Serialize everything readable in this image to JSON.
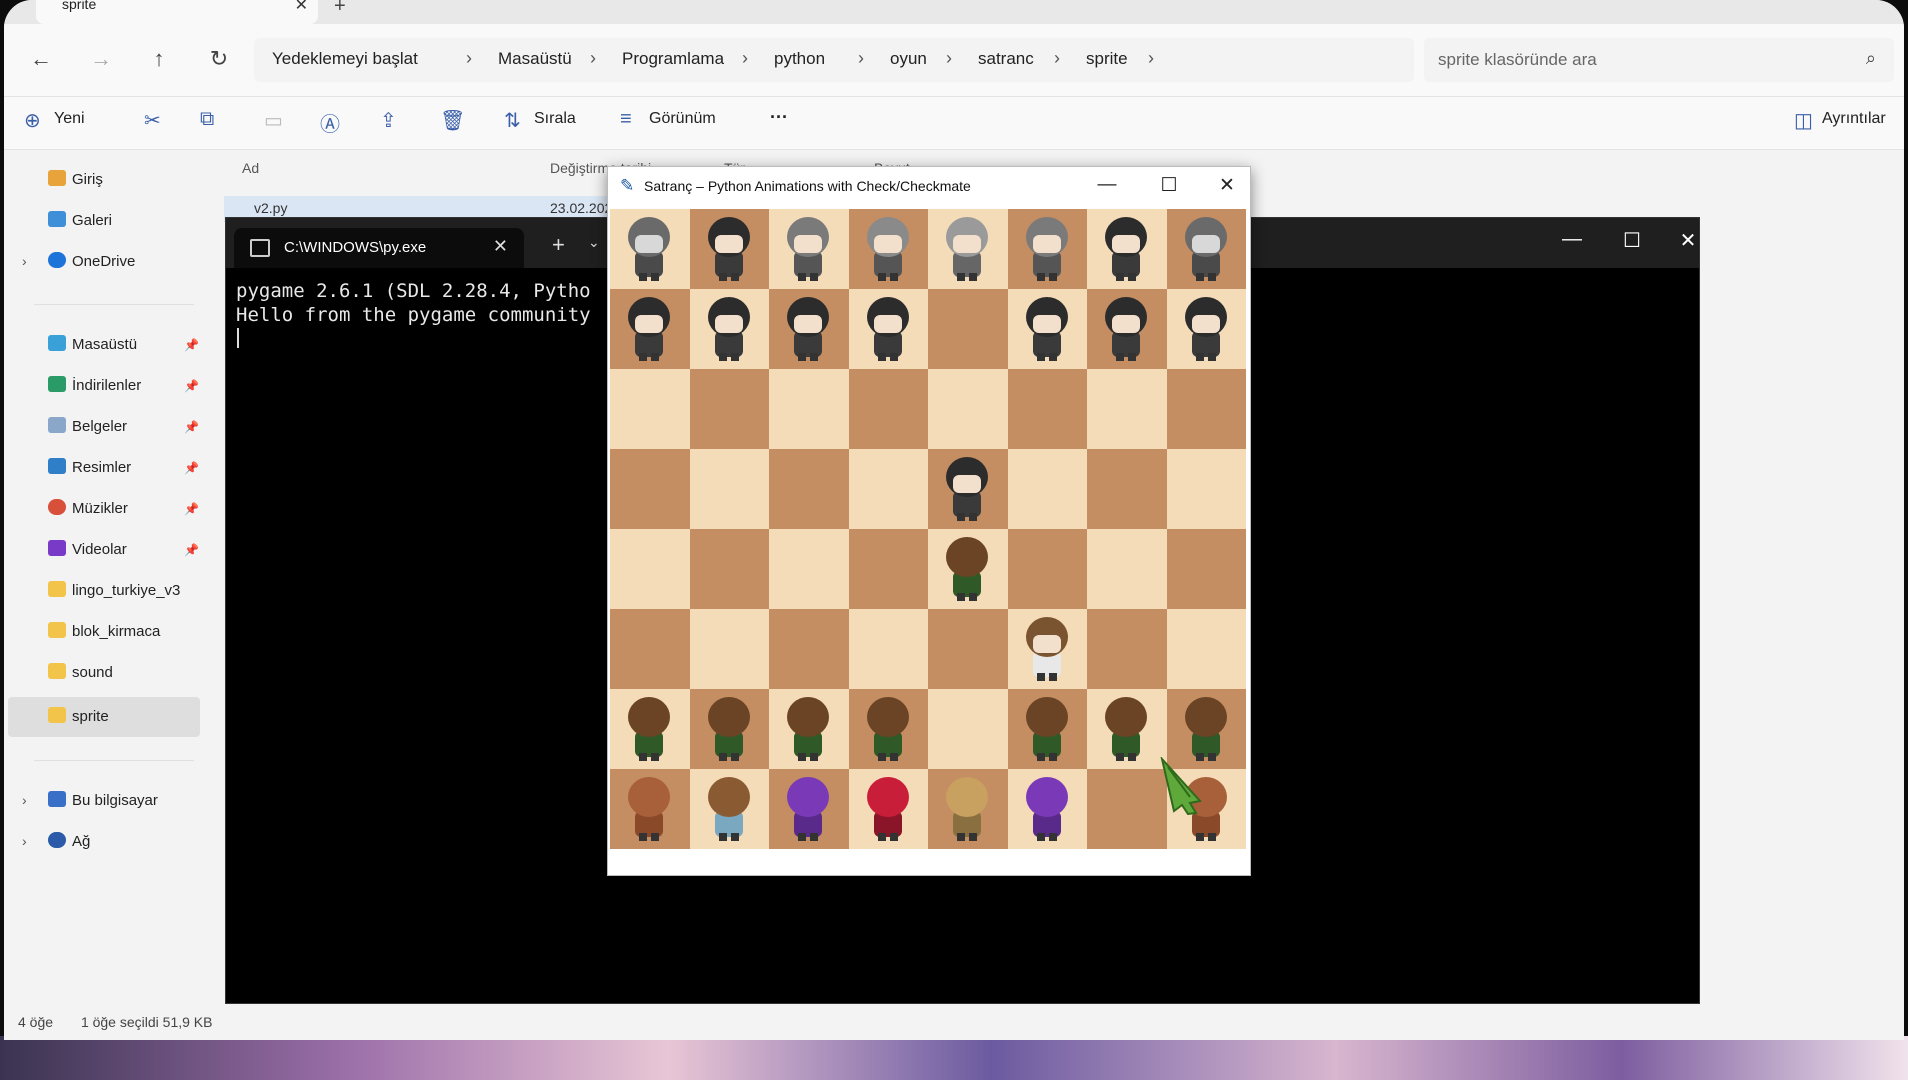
{
  "explorer": {
    "tab_title": "sprite",
    "tab_close": "✕",
    "tab_add": "+",
    "nav": {
      "back": "←",
      "forward": "→",
      "up": "↑",
      "refresh": "↻"
    },
    "breadcrumbs": [
      "Yedeklemeyi başlat",
      "Masaüstü",
      "Programlama",
      "python",
      "oyun",
      "satranc",
      "sprite"
    ],
    "breadcrumb_sep": "›",
    "search_placeholder": "sprite klasöründe ara",
    "search_icon": "⌕",
    "commands": {
      "new": "Yeni",
      "sort": "Sırala",
      "view": "Görünüm",
      "more": "···",
      "details": "Ayrıntılar"
    },
    "columns": [
      "Ad",
      "Değiştirme tarihi",
      "Tür",
      "Boyut"
    ],
    "file": {
      "name": "v2.py",
      "date": "23.02.202"
    },
    "sidebar": {
      "top": [
        "Giriş",
        "Galeri",
        "OneDrive"
      ],
      "pinned": [
        "Masaüstü",
        "İndirilenler",
        "Belgeler",
        "Resimler",
        "Müzikler",
        "Videolar"
      ],
      "folders": [
        "lingo_turkiye_v3",
        "blok_kirmaca",
        "sound",
        "sprite"
      ],
      "bottom": [
        "Bu bilgisayar",
        "Ağ"
      ]
    },
    "status": {
      "count": "4 öğe",
      "selected": "1 öğe seçildi 51,9 KB"
    }
  },
  "terminal": {
    "tab_title": "C:\\WINDOWS\\py.exe",
    "lines": [
      "pygame 2.6.1 (SDL 2.28.4, Pytho",
      "Hello from the pygame community"
    ],
    "controls": {
      "minimize": "—",
      "maximize": "☐",
      "close": "✕"
    },
    "tab_close": "✕",
    "tab_add": "+",
    "tab_dropdown": "⌄"
  },
  "chess": {
    "title": "Satranç – Python Animations with Check/Checkmate",
    "controls": {
      "minimize": "—",
      "maximize": "☐",
      "close": "✕"
    },
    "colors": {
      "light": "#f5dcb8",
      "dark": "#c48d62"
    },
    "board": [
      [
        "bear-gray",
        "kid-dark",
        "girl-gray",
        "girl-glasses",
        "man-glasses",
        "girl-gray",
        "kid-dark",
        "bear-gray"
      ],
      [
        "kid-dark",
        "kid-dark",
        "kid-dark",
        "kid-dark",
        "",
        "kid-dark",
        "kid-dark",
        "kid-dark"
      ],
      [
        "",
        "",
        "",
        "",
        "",
        "",
        "",
        ""
      ],
      [
        "",
        "",
        "",
        "",
        "kid-dark",
        "",
        "",
        ""
      ],
      [
        "",
        "",
        "",
        "",
        "kid-brown-back",
        "",
        "",
        ""
      ],
      [
        "",
        "",
        "",
        "",
        "",
        "kid-brown-front",
        "",
        ""
      ],
      [
        "kid-brown-back",
        "kid-brown-back",
        "kid-brown-back",
        "kid-brown-back",
        "",
        "kid-brown-back",
        "kid-brown-back",
        "kid-brown-back"
      ],
      [
        "bear-brown",
        "kid-light-back",
        "purple-blob",
        "red-blob",
        "blonde-kid",
        "purple-blob",
        "",
        "bear-brown"
      ]
    ]
  }
}
